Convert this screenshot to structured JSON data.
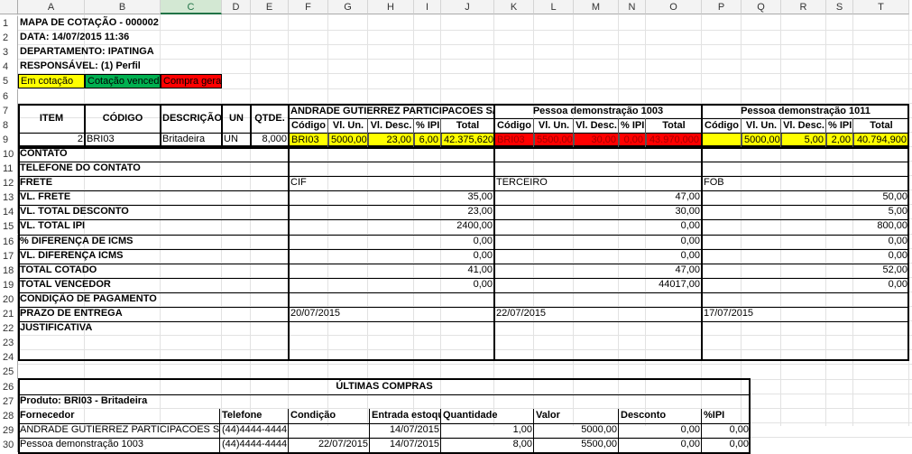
{
  "columns": [
    "A",
    "B",
    "C",
    "D",
    "E",
    "F",
    "G",
    "H",
    "I",
    "J",
    "K",
    "L",
    "M",
    "N",
    "O",
    "P",
    "Q",
    "R",
    "S",
    "T"
  ],
  "rows": [
    "1",
    "2",
    "3",
    "4",
    "5",
    "6",
    "7",
    "8",
    "9",
    "10",
    "11",
    "12",
    "13",
    "14",
    "15",
    "16",
    "17",
    "18",
    "19",
    "20",
    "21",
    "22",
    "23",
    "24",
    "25",
    "26",
    "27",
    "28",
    "29",
    "30"
  ],
  "header": {
    "title": "MAPA DE COTAÇÃO - 000002",
    "date": "DATA: 14/07/2015 11:36",
    "department": "DEPARTAMENTO: IPATINGA",
    "responsible": "RESPONSÁVEL: (1) Perfil"
  },
  "legend": [
    {
      "label": "Em cotação",
      "color": "#ffff00"
    },
    {
      "label": "Cotação vencedora",
      "color": "#00b050"
    },
    {
      "label": "Compra gerada",
      "color": "#ff0000"
    }
  ],
  "item_headers": {
    "item": "ITEM",
    "code": "CÓDIGO",
    "description": "DESCRIÇÃO",
    "unit": "UN",
    "qty": "QTDE."
  },
  "supplier_subheaders": [
    "Código",
    "Vl. Un.",
    "Vl. Desc.",
    "% IPI",
    "Total"
  ],
  "suppliers": [
    {
      "name": "ANDRADE GUTIERREZ PARTICIPACOES S/A",
      "code": "BRI03",
      "unit_value": "5000,00",
      "discount": "23,00",
      "ipi": "6,00",
      "total": "42.375,620",
      "status_color": "#ffff00",
      "frete": "CIF",
      "vl_frete": "35,00",
      "vl_desconto": "23,00",
      "vl_ipi": "2400,00",
      "pct_icms": "0,00",
      "vl_icms": "0,00",
      "total_cotado": "41,00",
      "total_vencedor": "0,00",
      "prazo": "20/07/2015"
    },
    {
      "name": "Pessoa demonstração 1003",
      "code": "BRI03",
      "unit_value": "5500,00",
      "discount": "30,00",
      "ipi": "0,00",
      "total": "43.970,000",
      "status_color": "#ff0000",
      "frete": "TERCEIRO",
      "vl_frete": "47,00",
      "vl_desconto": "30,00",
      "vl_ipi": "0,00",
      "pct_icms": "0,00",
      "vl_icms": "0,00",
      "total_cotado": "47,00",
      "total_vencedor": "44017,00",
      "prazo": "22/07/2015"
    },
    {
      "name": "Pessoa demonstração 1011",
      "code": "",
      "unit_value": "5000,00",
      "discount": "5,00",
      "ipi": "2,00",
      "total": "40.794,900",
      "status_color": "#ffff00",
      "frete": "FOB",
      "vl_frete": "50,00",
      "vl_desconto": "5,00",
      "vl_ipi": "800,00",
      "pct_icms": "0,00",
      "vl_icms": "0,00",
      "total_cotado": "52,00",
      "total_vencedor": "0,00",
      "prazo": "17/07/2015"
    }
  ],
  "item": {
    "number": "2",
    "code": "BRI03",
    "description": "Britadeira",
    "unit": "UN",
    "qty": "8,000"
  },
  "row_labels": [
    "CONTATO",
    "TELEFONE DO CONTATO",
    "FRETE",
    "VL. FRETE",
    "VL. TOTAL DESCONTO",
    "VL. TOTAL IPI",
    "% DIFERENÇA DE ICMS",
    "VL. DIFERENÇA ICMS",
    "TOTAL COTADO",
    "TOTAL VENCEDOR",
    "CONDIÇÃO DE PAGAMENTO",
    "PRAZO DE ENTREGA",
    "JUSTIFICATIVA"
  ],
  "last_purchases": {
    "title": "ÚLTIMAS COMPRAS",
    "product": "Produto: BRI03 - Britadeira",
    "headers": [
      "Fornecedor",
      "Telefone",
      "Condição",
      "Entrada estoque",
      "Quantidade",
      "Valor",
      "Desconto",
      "%IPI"
    ],
    "rows": [
      [
        "ANDRADE GUTIERREZ PARTICIPACOES S/A",
        "(44)4444-4444",
        "",
        "14/07/2015",
        "1,00",
        "5000,00",
        "0,00",
        "0,00"
      ],
      [
        "Pessoa demonstração 1003",
        "(44)4444-4444",
        "22/07/2015",
        "14/07/2015",
        "8,00",
        "5500,00",
        "0,00",
        "0,00"
      ]
    ]
  }
}
